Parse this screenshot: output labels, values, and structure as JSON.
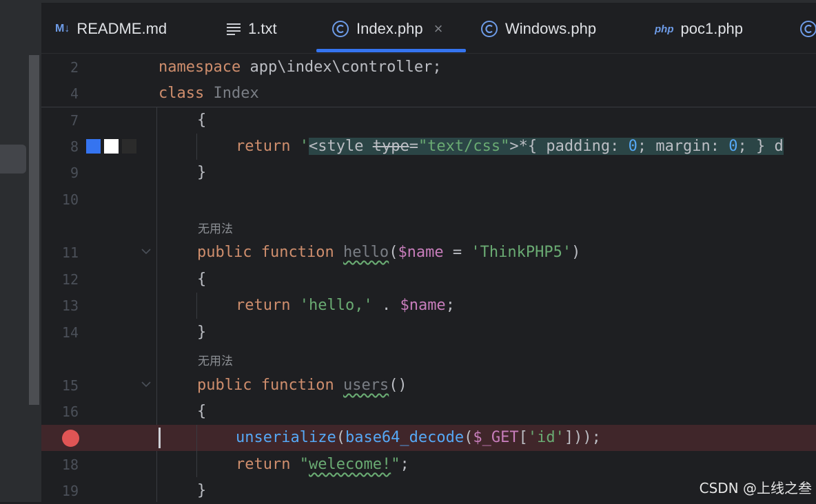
{
  "tabs": [
    {
      "label": "README.md",
      "icon": "markdown-icon",
      "icon_text": "M↓"
    },
    {
      "label": "1.txt",
      "icon": "text-file-icon"
    },
    {
      "label": "Index.php",
      "icon": "php-class-icon",
      "active": true
    },
    {
      "label": "Windows.php",
      "icon": "php-class-icon"
    },
    {
      "label": "poc1.php",
      "icon": "php-file-icon",
      "icon_text": "php"
    }
  ],
  "colors": {
    "accent": "#3574f0",
    "breakpoint": "#e05555",
    "background": "#1e1f22"
  },
  "sticky": {
    "line2": {
      "num": "2",
      "kw": "namespace",
      "rest": " app\\index\\controller;"
    },
    "line4": {
      "num": "4",
      "kw": "class",
      "name": "Index"
    }
  },
  "editor": {
    "line_numbers": [
      "7",
      "8",
      "9",
      "10",
      "11",
      "12",
      "13",
      "14",
      "15",
      "16",
      "18",
      "19"
    ],
    "hint_unused": "无用法",
    "l7": "{",
    "l8": {
      "kw": "return",
      "q": "'",
      "tag_open": "<style ",
      "attr": "type",
      "eq": "=",
      "attr_val": "\"text/css\"",
      "gt": ">*{ padding: ",
      "n0a": "0",
      "mid": "; margin: ",
      "n0b": "0",
      "end": "; } d"
    },
    "l9": "}",
    "l11": {
      "mod": "public",
      "kw": "function",
      "name": "hello",
      "open": "(",
      "var": "$name",
      "eq": " = ",
      "default": "'ThinkPHP5'",
      "close": ")"
    },
    "l12": "{",
    "l13": {
      "kw": "return",
      "str": "'hello,'",
      "dot": " . ",
      "var": "$name",
      "semi": ";"
    },
    "l14": "}",
    "l15": {
      "mod": "public",
      "kw": "function",
      "name": "users",
      "parens": "()"
    },
    "l16": "{",
    "l17": {
      "fn1": "unserialize",
      "p1": "(",
      "fn2": "base64_decode",
      "p2": "(",
      "var": "$_GET",
      "b1": "[",
      "key": "'id'",
      "b2": "]));"
    },
    "l18": {
      "kw": "return",
      "q1": "\"",
      "word": "welecome!",
      "q2": "\"",
      "semi": ";"
    },
    "l19": "}"
  },
  "swatch_colors": [
    "#3574f0",
    "#ffffff",
    "#2b2b2b"
  ],
  "watermark": "CSDN @上线之叁"
}
